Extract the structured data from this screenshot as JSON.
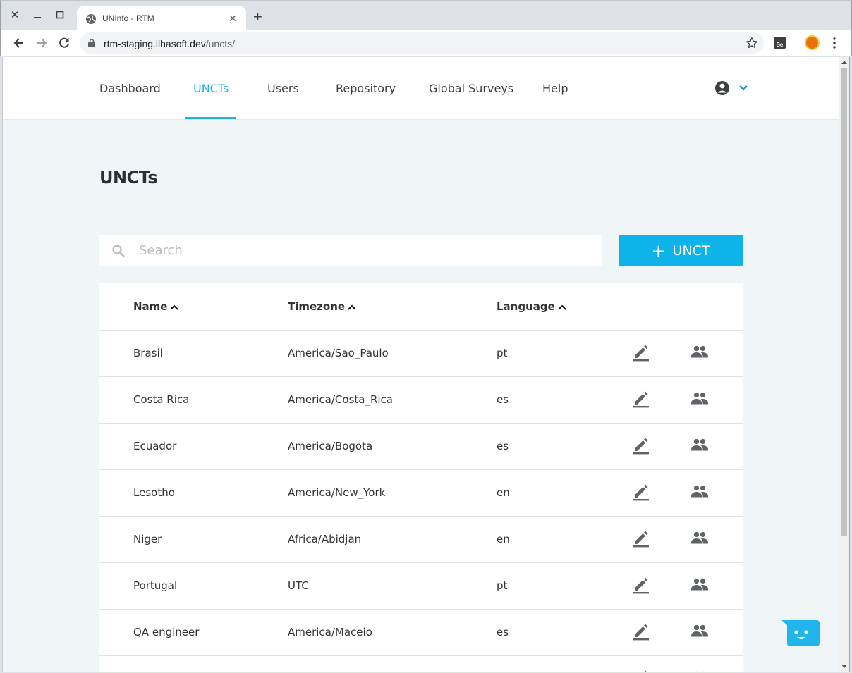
{
  "browser": {
    "tab_title": "UNInfo - RTM",
    "url_host": "rtm-staging.ilhasoft.dev",
    "url_path": "/uncts/"
  },
  "nav": {
    "items": [
      {
        "label": "Dashboard"
      },
      {
        "label": "UNCTs",
        "active": true
      },
      {
        "label": "Users"
      },
      {
        "label": "Repository"
      },
      {
        "label": "Global Surveys"
      },
      {
        "label": "Help"
      }
    ]
  },
  "page": {
    "title": "UNCTs",
    "search_placeholder": "Search",
    "add_button_label": "UNCT"
  },
  "table": {
    "headers": {
      "name": "Name",
      "timezone": "Timezone",
      "language": "Language"
    },
    "rows": [
      {
        "name": "Brasil",
        "timezone": "America/Sao_Paulo",
        "language": "pt"
      },
      {
        "name": "Costa Rica",
        "timezone": "America/Costa_Rica",
        "language": "es"
      },
      {
        "name": "Ecuador",
        "timezone": "America/Bogota",
        "language": "es"
      },
      {
        "name": "Lesotho",
        "timezone": "America/New_York",
        "language": "en"
      },
      {
        "name": "Niger",
        "timezone": "Africa/Abidjan",
        "language": "en"
      },
      {
        "name": "Portugal",
        "timezone": "UTC",
        "language": "pt"
      },
      {
        "name": "QA engineer",
        "timezone": "America/Maceio",
        "language": "es"
      },
      {
        "name": "",
        "timezone": "",
        "language": ""
      }
    ]
  },
  "colors": {
    "accent": "#1cb1e4",
    "button": "#0eb4e9",
    "page_bg": "#f0f5f7"
  },
  "icons": {
    "row_actions": [
      "edit-icon",
      "people-icon"
    ],
    "sort": "chevron-up-icon",
    "chat": "chat-bot-icon"
  }
}
